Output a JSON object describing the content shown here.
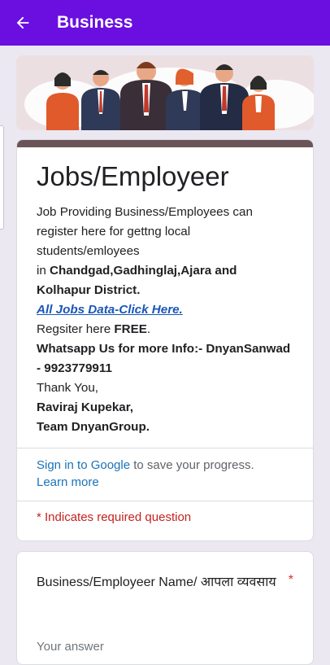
{
  "appbar": {
    "title": "Business",
    "back_icon": "arrow-left-icon"
  },
  "banner": {
    "image": "business-people-illustration"
  },
  "intro": {
    "title": "Jobs/Employeer",
    "line1": "Job Providing Business/Employees can register here for gettng local students/emloyees",
    "line2_prefix": "in ",
    "line2_bold": "Chandgad,Gadhinglaj,Ajara and Kolhapur District.",
    "link": "All Jobs Data-Click Here.",
    "register_prefix": "Regsiter here ",
    "register_bold": "FREE",
    "register_suffix": ".",
    "whatsapp": "Whatsapp Us for more Info:- DnyanSanwad - 9923779911",
    "thanks": "Thank You,",
    "name": "Raviraj Kupekar,",
    "team": "Team DnyanGroup."
  },
  "signin": {
    "link": "Sign in to Google",
    "text": " to save your progress.",
    "learn_more": "Learn more"
  },
  "required_note": "* Indicates required question",
  "question1": {
    "title": "Business/Employeer Name/ आपला व्यवसाय",
    "required_mark": "*",
    "placeholder": "Your answer"
  },
  "colors": {
    "appbar": "#6a0fe0",
    "accent_strip": "#6b5458",
    "link": "#1a73b8",
    "error": "#c5221f"
  }
}
